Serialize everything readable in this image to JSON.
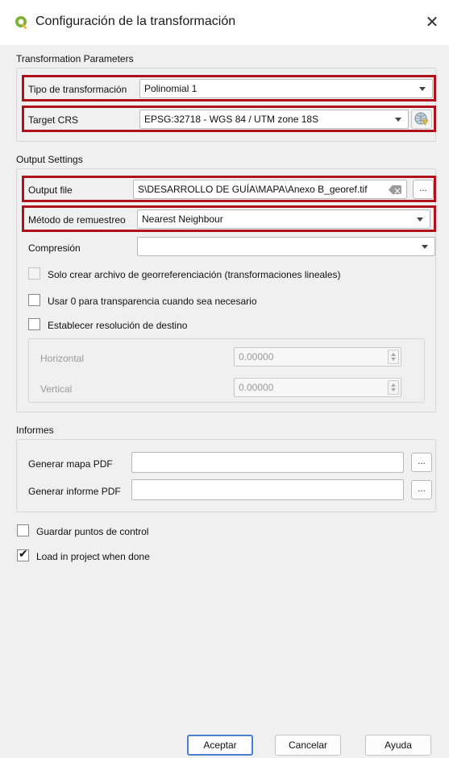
{
  "window": {
    "title": "Configuración de la transformación",
    "close_glyph": "✕",
    "app_icon": "qgis-logo-icon"
  },
  "transformation": {
    "section_title": "Transformation Parameters",
    "type_label": "Tipo de transformación",
    "type_value": "Polinomial 1",
    "crs_label": "Target CRS",
    "crs_value": "EPSG:32718 - WGS 84 / UTM zone 18S",
    "crs_button_icon": "globe-crs-icon"
  },
  "output": {
    "section_title": "Output Settings",
    "file_label": "Output file",
    "file_value": "S\\DESARROLLO DE GUÍA\\MAPA\\Anexo B_georef.tif",
    "browse_label": "...",
    "resample_label": "Método de remuestreo",
    "resample_value": "Nearest Neighbour",
    "compression_label": "Compresión",
    "compression_value": "",
    "world_file_label": "Solo crear archivo de georreferenciación (transformaciones lineales)",
    "world_file_checked": false,
    "zero_transparency_label": "Usar 0 para transparencia cuando sea necesario",
    "zero_transparency_checked": false,
    "set_resolution_label": "Establecer resolución de destino",
    "set_resolution_checked": false,
    "horizontal_label": "Horizontal",
    "horizontal_value": "0.00000",
    "vertical_label": "Vertical",
    "vertical_value": "0.00000"
  },
  "reports": {
    "section_title": "Informes",
    "pdf_map_label": "Generar mapa PDF",
    "pdf_map_value": "",
    "pdf_report_label": "Generar informe PDF",
    "pdf_report_value": "",
    "browse_label": "..."
  },
  "options": {
    "save_gcp_label": "Guardar puntos de control",
    "save_gcp_checked": false,
    "load_in_project_label": "Load in project when done",
    "load_in_project_checked": true,
    "check_glyph": "✔"
  },
  "buttons": {
    "ok": "Aceptar",
    "cancel": "Cancelar",
    "help": "Ayuda"
  },
  "colors": {
    "highlight_border": "#b0121b",
    "primary_button_border": "#4a7fd0",
    "dialog_background": "#f0f0f0"
  }
}
